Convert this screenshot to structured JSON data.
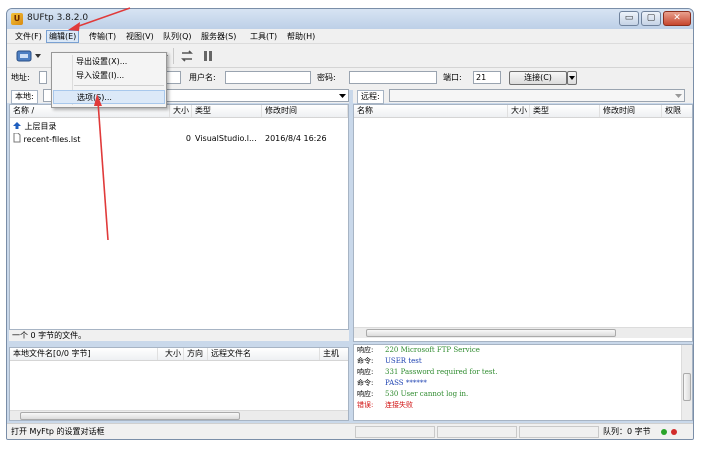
{
  "window": {
    "title": "8UFtp 3.8.2.0",
    "minimize": "▭",
    "maximize": "▢",
    "close": "✕"
  },
  "menu": [
    "文件(F)",
    "编辑(E)",
    "传输(T)",
    "视图(V)",
    "队列(Q)",
    "服务器(S)",
    "工具(T)",
    "帮助(H)"
  ],
  "edit_menu": [
    "导出设置(X)...",
    "导入设置(I)...",
    "选项(S)..."
  ],
  "toolbar_partial": "新",
  "address": {
    "addr_label": "地址:",
    "user_label": "用户名:",
    "pass_label": "密码:",
    "port_label": "端口:",
    "port_value": "21",
    "connect_label": "连接(C)"
  },
  "local": {
    "path_label": "本地:",
    "columns": [
      "名称 /",
      "大小",
      "类型",
      "修改时间"
    ],
    "rows": [
      {
        "name": "上层目录",
        "size": "",
        "type": "",
        "mtime": ""
      },
      {
        "name": "recent-files.lst",
        "size": "0",
        "type": "VisualStudio.l...",
        "mtime": "2016/8/4 16:26"
      }
    ],
    "status": "一个 0 字节的文件。"
  },
  "remote": {
    "path_label": "远程:",
    "columns": [
      "名称",
      "大小",
      "类型",
      "修改时间",
      "权限"
    ]
  },
  "queue": {
    "columns": [
      "本地文件名[0/0 字节]",
      "大小",
      "方向",
      "远程文件名",
      "主机"
    ]
  },
  "log": [
    {
      "tag": "响应:",
      "msg": "220 Microsoft FTP Service",
      "color": "#2e8b2e"
    },
    {
      "tag": "命令:",
      "msg": "USER test",
      "color": "#1a3fb0"
    },
    {
      "tag": "响应:",
      "msg": "331 Password required for test.",
      "color": "#2e8b2e"
    },
    {
      "tag": "命令:",
      "msg": "PASS ******",
      "color": "#1a3fb0"
    },
    {
      "tag": "响应:",
      "msg": "530 User cannot log in.",
      "color": "#2e8b2e"
    },
    {
      "tag": "错误:",
      "msg": "连接失败",
      "color": "#d01010"
    }
  ],
  "statusbar": {
    "message": "打开 MyFtp 的设置对话框",
    "queue": "队列：0 字节"
  },
  "accent": {
    "annotation": "#e03a3a",
    "selection": "#dce9f8"
  }
}
